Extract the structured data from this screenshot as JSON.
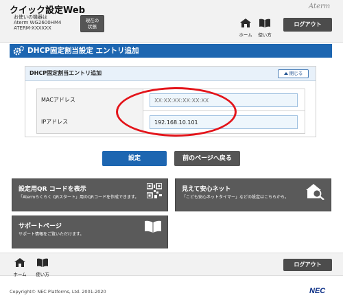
{
  "header": {
    "app_title": "クイック設定Web",
    "device_caption": "お使いの機器は",
    "device_model": "Aterm WG2600HM4",
    "device_name": "ATERM-XXXXXX",
    "status_button": "現在の\n状態",
    "brand_logo": "Aterm",
    "nav": {
      "home_label": "ホーム",
      "help_label": "使い方"
    },
    "logout_label": "ログアウト"
  },
  "page": {
    "title": "DHCP固定割当設定 エントリ追加"
  },
  "panel": {
    "title": "DHCP固定割当エントリ追加",
    "collapse_label": "閉じる",
    "fields": [
      {
        "label": "MACアドレス",
        "value": "",
        "placeholder": "XX:XX:XX:XX:XX:XX"
      },
      {
        "label": "IPアドレス",
        "value": "192.168.10.101",
        "placeholder": ""
      }
    ]
  },
  "actions": {
    "submit_label": "設定",
    "back_label": "前のページへ戻る"
  },
  "tiles": [
    {
      "title": "設定用QR コードを表示",
      "desc": "「Atermらくらく QRスタート」用のQRコードを作成できます。",
      "icon": "qr-code-icon"
    },
    {
      "title": "見えて安心ネット",
      "desc": "「こども安心ネットタイマー」などの設定はこちらから。",
      "icon": "home-search-icon"
    },
    {
      "title": "サポートページ",
      "desc": "サポート情報をご覧いただけます。",
      "icon": "book-icon"
    }
  ],
  "footer": {
    "home_label": "ホーム",
    "help_label": "使い方",
    "logout_label": "ログアウト",
    "copyright": "Copyright© NEC Platforms, Ltd. 2001-2020",
    "brand": "NEC"
  },
  "colors": {
    "primary_blue": "#1d66b1",
    "dark_button": "#4c4c4c",
    "highlight_red": "#e3141a"
  }
}
